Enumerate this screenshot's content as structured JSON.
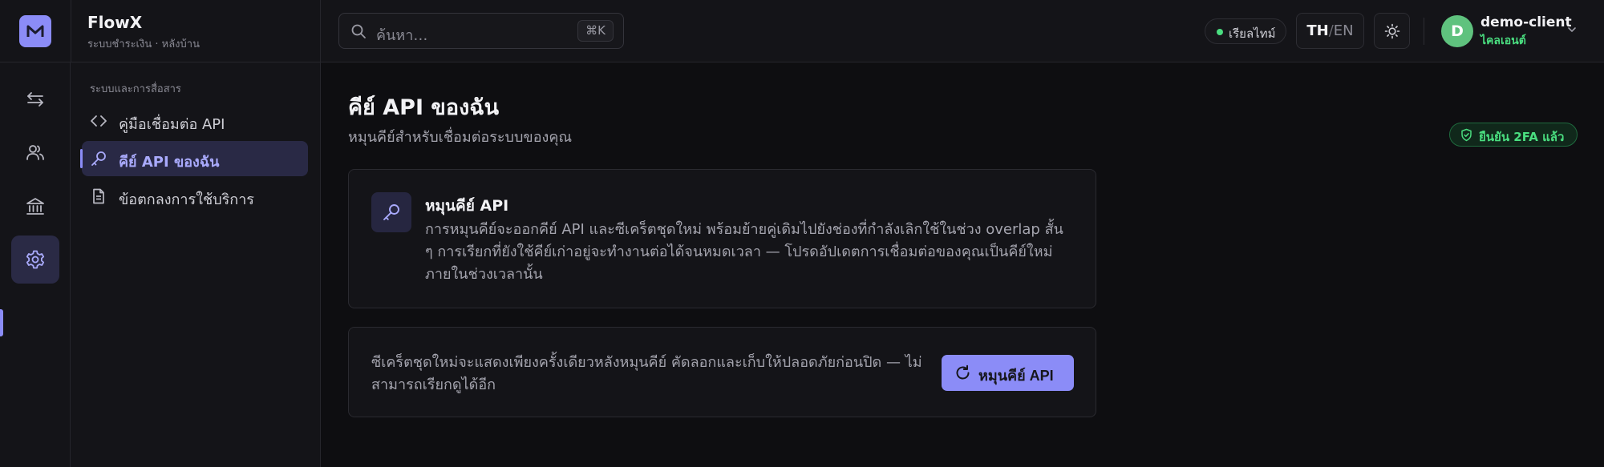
{
  "header": {
    "brand_name": "FlowX",
    "brand_sub": "ระบบชำระเงิน · หลังบ้าน",
    "search_placeholder": "ค้นหา…",
    "search_shortcut": "⌘K",
    "live_label": "เรียลไทม์",
    "lang_th": "TH",
    "lang_sep": "/",
    "lang_en": "EN",
    "user": {
      "initial": "D",
      "name": "demo-client",
      "role": "ไคลเอนต์"
    }
  },
  "rail": {
    "items": [
      {
        "icon": "transfer-arrows-icon"
      },
      {
        "icon": "users-icon"
      },
      {
        "icon": "bank-icon"
      },
      {
        "icon": "gear-icon",
        "active": true
      }
    ]
  },
  "sidebar": {
    "section_title": "ระบบและการสื่อสาร",
    "items": [
      {
        "label": "คู่มือเชื่อมต่อ API",
        "icon": "code-icon"
      },
      {
        "label": "คีย์ API ของฉัน",
        "icon": "key-icon",
        "active": true
      },
      {
        "label": "ข้อตกลงการใช้บริการ",
        "icon": "document-icon"
      }
    ]
  },
  "main": {
    "title": "คีย์ API ของฉัน",
    "subtitle": "หมุนคีย์สำหรับเชื่อมต่อระบบของคุณ",
    "badge_2fa": "ยืนยัน 2FA แล้ว",
    "rotate_card": {
      "title": "หมุนคีย์ API",
      "body": "การหมุนคีย์จะออกคีย์ API และซีเคร็ตชุดใหม่ พร้อมย้ายคู่เดิมไปยังช่องที่กำลังเลิกใช้ในช่วง overlap สั้น ๆ การเรียกที่ยังใช้คีย์เก่าอยู่จะทำงานต่อได้จนหมดเวลา — โปรดอัปเดตการเชื่อมต่อของคุณเป็นคีย์ใหม่ภายในช่วงเวลานั้น"
    },
    "secret_card": {
      "text": "ซีเคร็ตชุดใหม่จะแสดงเพียงครั้งเดียวหลังหมุนคีย์ คัดลอกและเก็บให้ปลอดภัยก่อนปิด — ไม่สามารถเรียกดูได้อีก",
      "button_label": "หมุนคีย์ API"
    }
  },
  "colors": {
    "accent": "#8b8cf7",
    "success": "#4ade80",
    "background": "#0e0e11",
    "panel": "#141418"
  }
}
